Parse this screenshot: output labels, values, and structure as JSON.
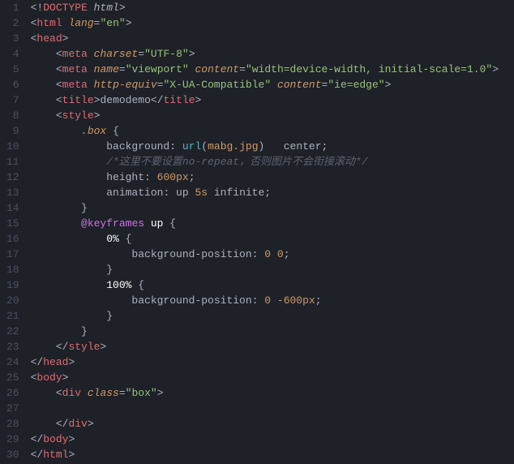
{
  "lineCount": 30,
  "tokens": [
    [
      [
        "p-punc",
        "<!"
      ],
      [
        "p-tag",
        "DOCTYPE"
      ],
      [
        "p-doctype",
        " html"
      ],
      [
        "p-punc",
        ">"
      ]
    ],
    [
      [
        "p-punc",
        "<"
      ],
      [
        "p-tag",
        "html"
      ],
      [
        "p-attr",
        " lang"
      ],
      [
        "p-punc",
        "="
      ],
      [
        "p-str",
        "\"en\""
      ],
      [
        "p-punc",
        ">"
      ]
    ],
    [
      [
        "p-punc",
        "<"
      ],
      [
        "p-tag",
        "head"
      ],
      [
        "p-punc",
        ">"
      ]
    ],
    [
      [
        "p-prop",
        "    "
      ],
      [
        "p-punc",
        "<"
      ],
      [
        "p-tag",
        "meta"
      ],
      [
        "p-attr",
        " charset"
      ],
      [
        "p-punc",
        "="
      ],
      [
        "p-str",
        "\"UTF-8\""
      ],
      [
        "p-punc",
        ">"
      ]
    ],
    [
      [
        "p-prop",
        "    "
      ],
      [
        "p-punc",
        "<"
      ],
      [
        "p-tag",
        "meta"
      ],
      [
        "p-attr",
        " name"
      ],
      [
        "p-punc",
        "="
      ],
      [
        "p-str",
        "\"viewport\""
      ],
      [
        "p-attr",
        " content"
      ],
      [
        "p-punc",
        "="
      ],
      [
        "p-str",
        "\"width=device-width, initial-scale=1.0\""
      ],
      [
        "p-punc",
        ">"
      ]
    ],
    [
      [
        "p-prop",
        "    "
      ],
      [
        "p-punc",
        "<"
      ],
      [
        "p-tag",
        "meta"
      ],
      [
        "p-attr",
        " http-equiv"
      ],
      [
        "p-punc",
        "="
      ],
      [
        "p-str",
        "\"X-UA-Compatible\""
      ],
      [
        "p-attr",
        " content"
      ],
      [
        "p-punc",
        "="
      ],
      [
        "p-str",
        "\"ie=edge\""
      ],
      [
        "p-punc",
        ">"
      ]
    ],
    [
      [
        "p-prop",
        "    "
      ],
      [
        "p-punc",
        "<"
      ],
      [
        "p-tag",
        "title"
      ],
      [
        "p-punc",
        ">"
      ],
      [
        "p-prop",
        "demodemo"
      ],
      [
        "p-punc",
        "</"
      ],
      [
        "p-tag",
        "title"
      ],
      [
        "p-punc",
        ">"
      ]
    ],
    [
      [
        "p-prop",
        "    "
      ],
      [
        "p-punc",
        "<"
      ],
      [
        "p-tag",
        "style"
      ],
      [
        "p-punc",
        ">"
      ]
    ],
    [
      [
        "p-prop",
        "        "
      ],
      [
        "p-sel",
        ".box"
      ],
      [
        "p-prop",
        " "
      ],
      [
        "p-punc",
        "{"
      ]
    ],
    [
      [
        "p-prop",
        "            background"
      ],
      [
        "p-punc",
        ":"
      ],
      [
        "p-prop",
        " "
      ],
      [
        "p-func",
        "url"
      ],
      [
        "p-punc",
        "("
      ],
      [
        "p-val",
        "mabg.jpg"
      ],
      [
        "p-punc",
        ")"
      ],
      [
        "p-prop",
        "   center"
      ],
      [
        "p-punc",
        ";"
      ]
    ],
    [
      [
        "p-prop",
        "            "
      ],
      [
        "p-comment",
        "/*这里不要设置no-repeat，否则图片不会衔接滚动*/"
      ]
    ],
    [
      [
        "p-prop",
        "            height"
      ],
      [
        "p-punc",
        ":"
      ],
      [
        "p-prop",
        " "
      ],
      [
        "p-val",
        "600px"
      ],
      [
        "p-punc",
        ";"
      ]
    ],
    [
      [
        "p-prop",
        "            animation"
      ],
      [
        "p-punc",
        ":"
      ],
      [
        "p-prop",
        " up "
      ],
      [
        "p-val",
        "5s"
      ],
      [
        "p-prop",
        " infinite"
      ],
      [
        "p-punc",
        ";"
      ]
    ],
    [
      [
        "p-prop",
        "        "
      ],
      [
        "p-punc",
        "}"
      ]
    ],
    [
      [
        "p-prop",
        "        "
      ],
      [
        "p-atrule",
        "@keyframes"
      ],
      [
        "p-prop",
        " "
      ],
      [
        "p-white",
        "up"
      ],
      [
        "p-prop",
        " "
      ],
      [
        "p-punc",
        "{"
      ]
    ],
    [
      [
        "p-prop",
        "            "
      ],
      [
        "p-white",
        "0%"
      ],
      [
        "p-prop",
        " "
      ],
      [
        "p-punc",
        "{"
      ]
    ],
    [
      [
        "p-prop",
        "                background-position"
      ],
      [
        "p-punc",
        ":"
      ],
      [
        "p-prop",
        " "
      ],
      [
        "p-val",
        "0"
      ],
      [
        "p-prop",
        " "
      ],
      [
        "p-val",
        "0"
      ],
      [
        "p-punc",
        ";"
      ]
    ],
    [
      [
        "p-prop",
        "            "
      ],
      [
        "p-punc",
        "}"
      ]
    ],
    [
      [
        "p-prop",
        "            "
      ],
      [
        "p-white",
        "100%"
      ],
      [
        "p-prop",
        " "
      ],
      [
        "p-punc",
        "{"
      ]
    ],
    [
      [
        "p-prop",
        "                background-position"
      ],
      [
        "p-punc",
        ":"
      ],
      [
        "p-prop",
        " "
      ],
      [
        "p-val",
        "0"
      ],
      [
        "p-prop",
        " "
      ],
      [
        "p-val",
        "-600px"
      ],
      [
        "p-punc",
        ";"
      ]
    ],
    [
      [
        "p-prop",
        "            "
      ],
      [
        "p-punc",
        "}"
      ]
    ],
    [
      [
        "p-prop",
        "        "
      ],
      [
        "p-punc",
        "}"
      ]
    ],
    [
      [
        "p-prop",
        "    "
      ],
      [
        "p-punc",
        "</"
      ],
      [
        "p-tag",
        "style"
      ],
      [
        "p-punc",
        ">"
      ]
    ],
    [
      [
        "p-punc",
        "</"
      ],
      [
        "p-tag",
        "head"
      ],
      [
        "p-punc",
        ">"
      ]
    ],
    [
      [
        "p-punc",
        "<"
      ],
      [
        "p-tag",
        "body"
      ],
      [
        "p-punc",
        ">"
      ]
    ],
    [
      [
        "p-prop",
        "    "
      ],
      [
        "p-punc",
        "<"
      ],
      [
        "p-tag",
        "div"
      ],
      [
        "p-attr",
        " class"
      ],
      [
        "p-punc",
        "="
      ],
      [
        "p-str",
        "\"box\""
      ],
      [
        "p-punc",
        ">"
      ]
    ],
    [],
    [
      [
        "p-prop",
        "    "
      ],
      [
        "p-punc",
        "</"
      ],
      [
        "p-tag",
        "div"
      ],
      [
        "p-punc",
        ">"
      ]
    ],
    [
      [
        "p-punc",
        "</"
      ],
      [
        "p-tag",
        "body"
      ],
      [
        "p-punc",
        ">"
      ]
    ],
    [
      [
        "p-punc",
        "</"
      ],
      [
        "p-tag",
        "html"
      ],
      [
        "p-punc",
        ">"
      ]
    ]
  ]
}
